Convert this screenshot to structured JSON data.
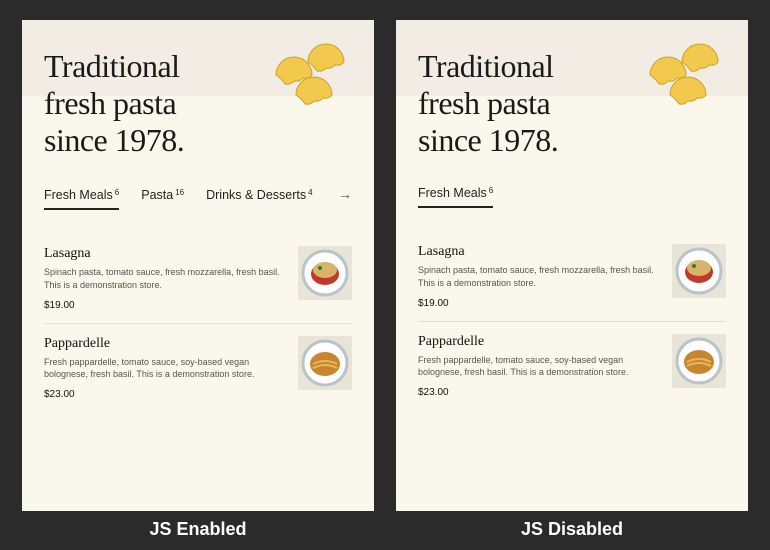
{
  "hero": {
    "title": "Traditional fresh pasta since 1978."
  },
  "tabs": [
    {
      "label": "Fresh Meals",
      "count": "6"
    },
    {
      "label": "Pasta",
      "count": "16"
    },
    {
      "label": "Drinks & Desserts",
      "count": "4"
    }
  ],
  "arrow": "→",
  "items": [
    {
      "name": "Lasagna",
      "desc": "Spinach pasta, tomato sauce, fresh mozzarella, fresh basil. This is a demonstration store.",
      "price": "$19.00"
    },
    {
      "name": "Pappardelle",
      "desc": "Fresh pappardelle, tomato sauce, soy-based vegan bolognese, fresh basil.   This is a demonstration store.",
      "price": "$23.00"
    }
  ],
  "captions": {
    "left": "JS Enabled",
    "right": "JS Disabled"
  }
}
